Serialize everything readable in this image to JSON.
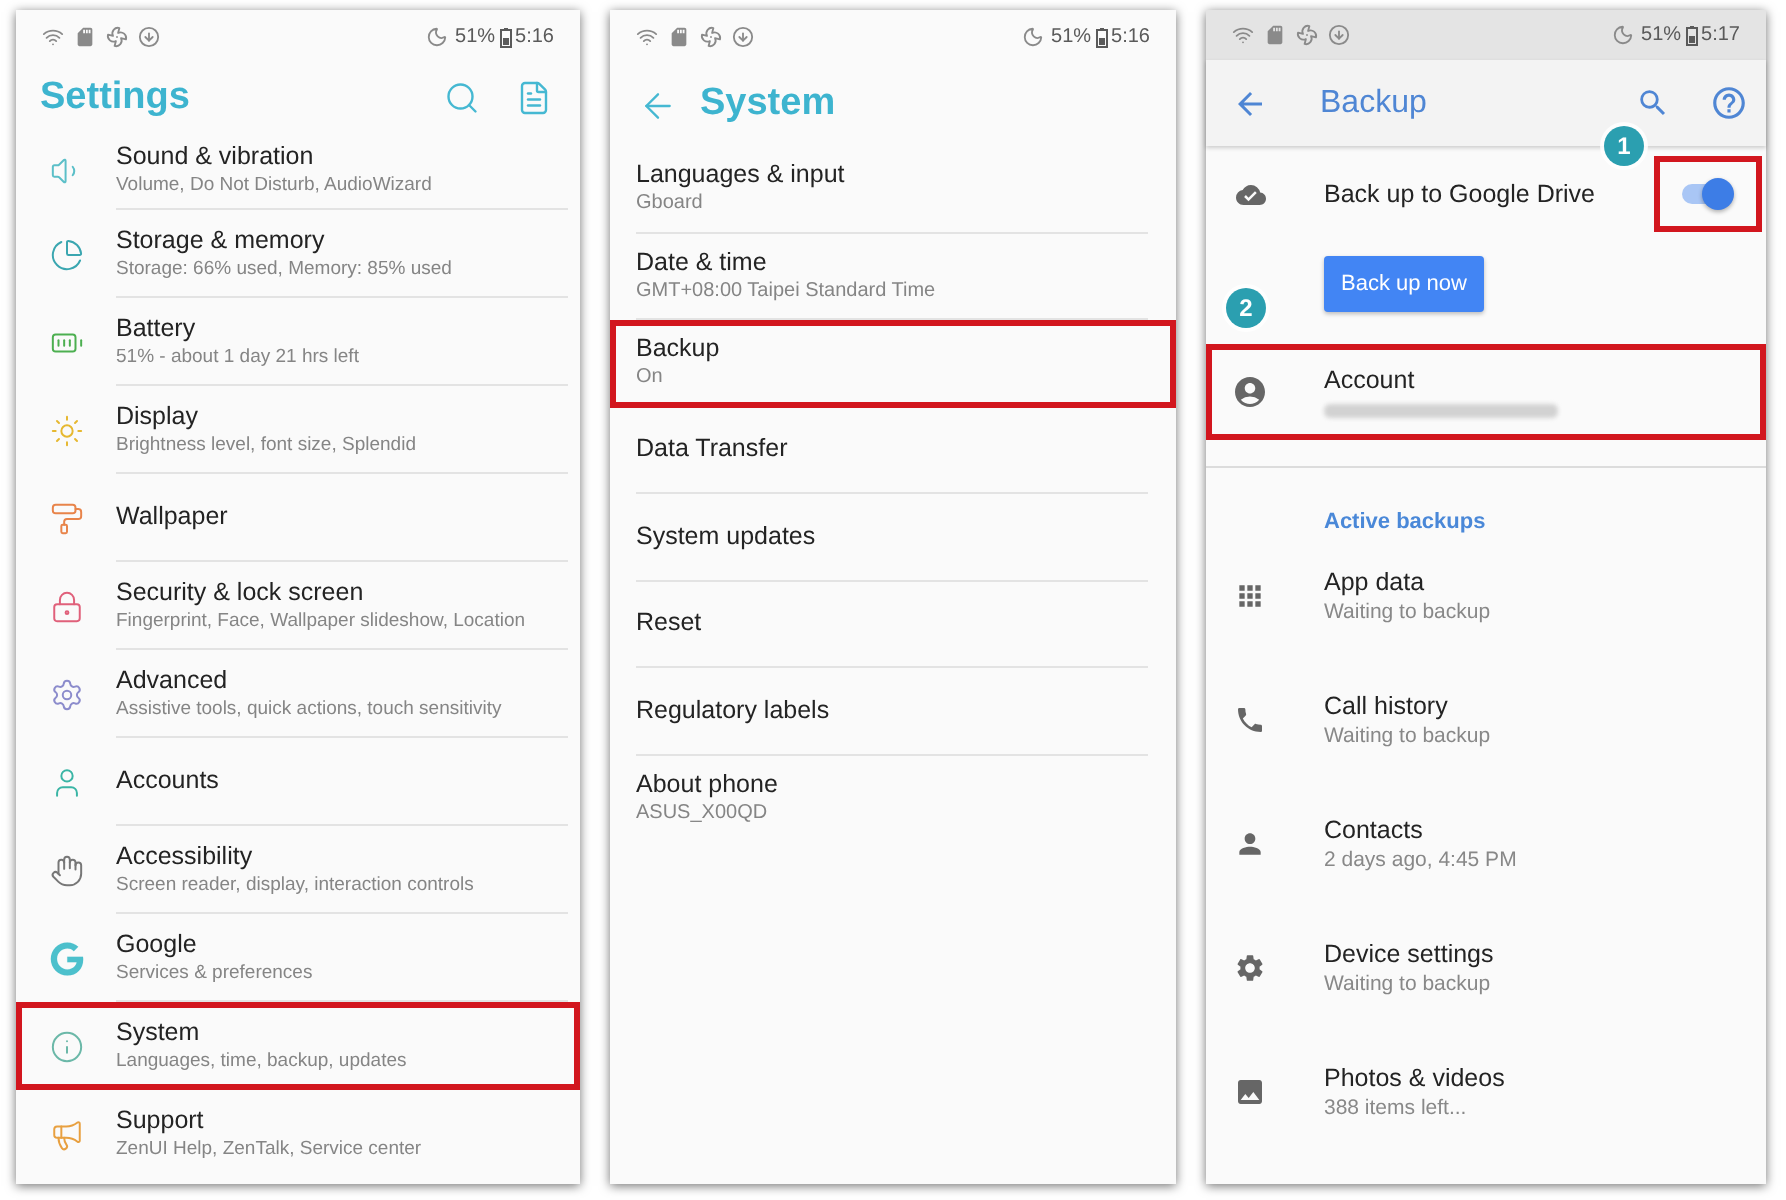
{
  "settings_screen": {
    "status_bar": {
      "battery": "51%",
      "time": "5:16"
    },
    "title": "Settings",
    "items": [
      {
        "title": "Sound & vibration",
        "subtitle": "Volume, Do Not Disturb, AudioWizard",
        "highlighted": false
      },
      {
        "title": "Storage & memory",
        "subtitle": "Storage: 66% used, Memory: 85% used",
        "highlighted": false
      },
      {
        "title": "Battery",
        "subtitle": "51% - about 1 day 21 hrs left",
        "highlighted": false
      },
      {
        "title": "Display",
        "subtitle": "Brightness level, font size, Splendid",
        "highlighted": false
      },
      {
        "title": "Wallpaper",
        "highlighted": false
      },
      {
        "title": "Security & lock screen",
        "subtitle": "Fingerprint, Face, Wallpaper slideshow, Location",
        "highlighted": false
      },
      {
        "title": "Advanced",
        "subtitle": "Assistive tools, quick actions, touch sensitivity",
        "highlighted": false
      },
      {
        "title": "Accounts",
        "highlighted": false
      },
      {
        "title": "Accessibility",
        "subtitle": "Screen reader, display, interaction controls",
        "highlighted": false
      },
      {
        "title": "Google",
        "subtitle": "Services & preferences",
        "highlighted": false
      },
      {
        "title": "System",
        "subtitle": "Languages, time, backup, updates",
        "highlighted": true
      },
      {
        "title": "Support",
        "subtitle": "ZenUI Help, ZenTalk, Service center",
        "highlighted": false
      }
    ]
  },
  "system_screen": {
    "status_bar": {
      "battery": "51%",
      "time": "5:16"
    },
    "title": "System",
    "items": [
      {
        "title": "Languages & input",
        "subtitle": "Gboard",
        "highlighted": false
      },
      {
        "title": "Date & time",
        "subtitle": "GMT+08:00 Taipei Standard Time",
        "highlighted": false
      },
      {
        "title": "Backup",
        "subtitle": "On",
        "highlighted": true
      },
      {
        "title": "Data Transfer",
        "highlighted": false
      },
      {
        "title": "System updates",
        "highlighted": false
      },
      {
        "title": "Reset",
        "highlighted": false
      },
      {
        "title": "Regulatory labels",
        "highlighted": false
      },
      {
        "title": "About phone",
        "subtitle": "ASUS_X00QD",
        "highlighted": false
      }
    ]
  },
  "backup_screen": {
    "status_bar": {
      "battery": "51%",
      "time": "5:17"
    },
    "title": "Backup",
    "drive_backup": {
      "label": "Back up to Google Drive",
      "on": true,
      "highlighted": true,
      "callout": "1"
    },
    "backup_button": "Back up now",
    "account": {
      "title": "Account",
      "highlighted": true,
      "callout": "2"
    },
    "section_title": "Active backups",
    "items": [
      {
        "title": "App data",
        "subtitle": "Waiting to backup"
      },
      {
        "title": "Call history",
        "subtitle": "Waiting to backup"
      },
      {
        "title": "Contacts",
        "subtitle": "2 days ago, 4:45 PM"
      },
      {
        "title": "Device settings",
        "subtitle": "Waiting to backup"
      },
      {
        "title": "Photos & videos",
        "subtitle": "388 items left..."
      }
    ]
  }
}
